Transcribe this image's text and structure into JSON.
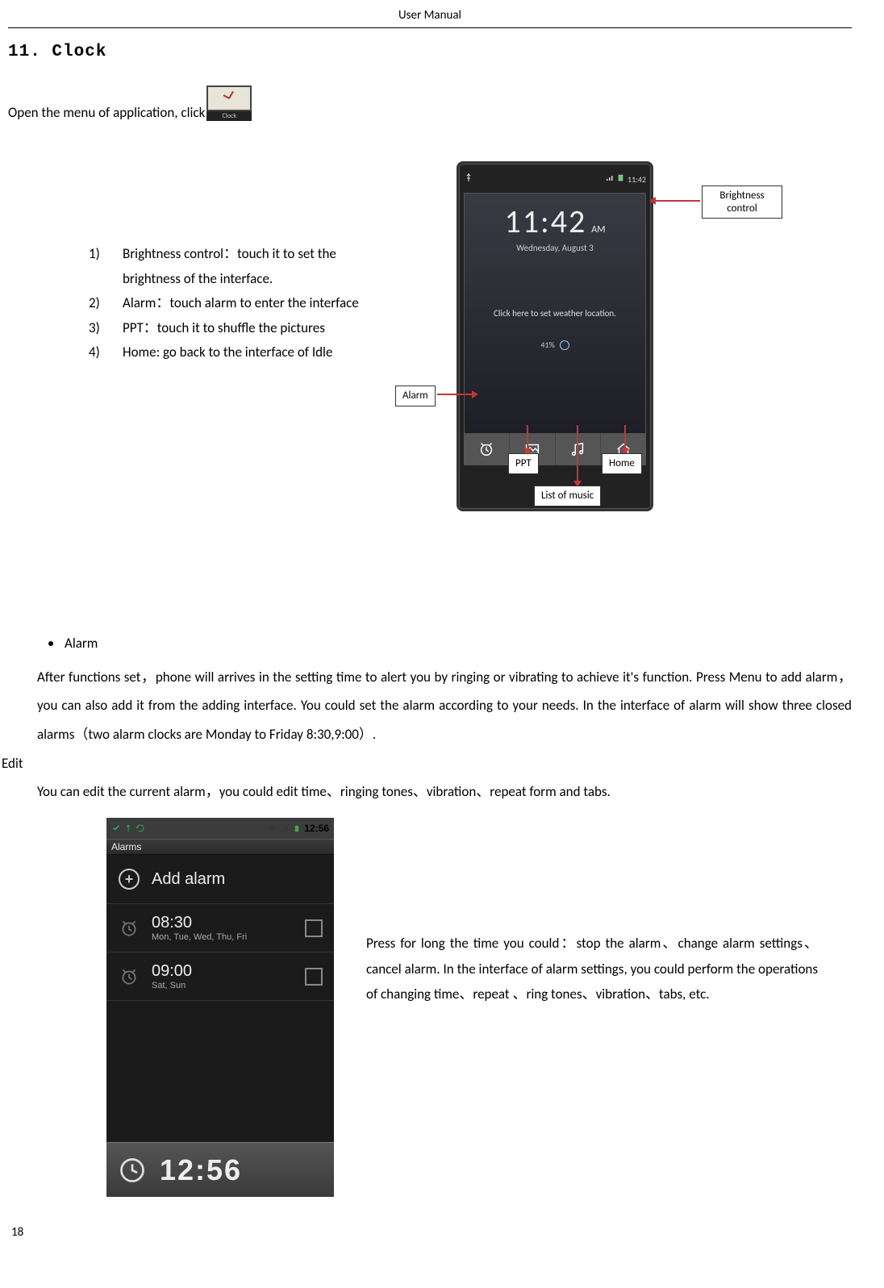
{
  "header": "User Manual",
  "section_title": "11. Clock",
  "open_line": "Open the menu of application, click",
  "clock_icon_label": "Clock",
  "features": [
    {
      "num": "1)",
      "text": "Brightness control：touch it to set the brightness of the interface."
    },
    {
      "num": "2)",
      "text": "Alarm：touch alarm to enter the interface"
    },
    {
      "num": "3)",
      "text": "PPT：touch it to shuffle the pictures"
    },
    {
      "num": "4)",
      "text": "Home: go back to the interface of Idle"
    }
  ],
  "phone1": {
    "status_time": "11:42",
    "time": "11:42",
    "ampm": "AM",
    "date": "Wednesday, August 3",
    "weather_hint": "Click here to set weather location.",
    "battery": "41%"
  },
  "callouts": {
    "brightness": "Brightness control",
    "alarm": "Alarm",
    "ppt": "PPT",
    "home": "Home",
    "music": "List  of  music"
  },
  "bullet_label": "Alarm",
  "para1": "After functions set，phone will arrives in the setting time to alert you by ringing or vibrating to achieve it's function. Press Menu to add alarm，you can also add it from the adding interface. You could set the alarm according to your needs. In the interface of alarm will show three closed alarms（two alarm clocks are Monday to Friday 8:30,9:00）.",
  "edit_label": "Edit",
  "para2": "You can edit the current alarm，you could edit time、ringing tones、vibration、repeat form and tabs.",
  "phone2": {
    "status_time": "12:56",
    "header": "Alarms",
    "add_label": "Add alarm",
    "alarms": [
      {
        "time": "08:30",
        "days": "Mon, Tue, Wed, Thu, Fri",
        "on": false
      },
      {
        "time": "09:00",
        "days": "Sat, Sun",
        "on": false
      }
    ],
    "big_time": "12:56"
  },
  "bottom_text": "Press for long the time you could：stop the alarm、change alarm  settings、 cancel  alarm.  In  the  interface  of  alarm settings,  you  could  perform  the  operations  of  changing time、repeat 、ring tones、vibration、tabs, etc.",
  "page_number": "18"
}
